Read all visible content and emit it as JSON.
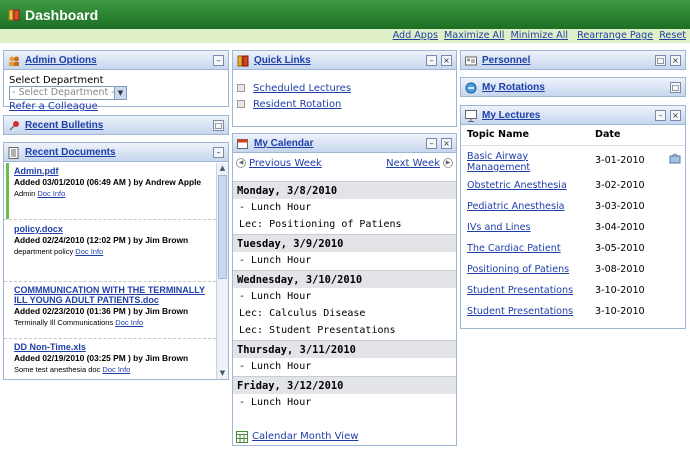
{
  "header": {
    "title": "Dashboard"
  },
  "toolbar": {
    "add_apps": "Add Apps",
    "maximize_all": "Maximize All",
    "minimize_all": "Minimize All",
    "rearrange_page": "Rearrange Page",
    "reset": "Reset"
  },
  "admin": {
    "title": "Admin Options",
    "select_label": "Select Department",
    "select_value": "- Select Department -",
    "refer": "Refer a Colleague"
  },
  "bulletins": {
    "title": "Recent Bulletins"
  },
  "documents": {
    "title": "Recent Documents",
    "doc_info": "Doc Info",
    "items": [
      {
        "name": "Admin.pdf",
        "added": "Added 03/01/2010 (06:49 AM ) by Andrew Apple",
        "desc": "Admin"
      },
      {
        "name": "policy.docx",
        "added": "Added 02/24/2010 (12:02 PM ) by Jim Brown",
        "desc": "department policy"
      },
      {
        "name": "COMMMUNICATION WITH THE TERMINALLY ILL YOUNG ADULT PATIENTS.doc",
        "added": "Added 02/23/2010 (01:36 PM ) by Jim Brown",
        "desc": "Terminally Ill Communications"
      },
      {
        "name": "DD Non-Time.xls",
        "added": "Added 02/19/2010 (03:25 PM ) by Jim Brown",
        "desc": "Some test anesthesia doc"
      }
    ]
  },
  "quicklinks": {
    "title": "Quick Links",
    "items": [
      "Scheduled Lectures",
      "Resident Rotation"
    ]
  },
  "calendar": {
    "title": "My Calendar",
    "prev": "Previous Week",
    "next": "Next Week",
    "month_view": "Calendar Month View",
    "days": [
      {
        "date": "Monday, 3/8/2010",
        "items": [
          "- Lunch Hour",
          "Lec: Positioning of Patiens"
        ]
      },
      {
        "date": "Tuesday, 3/9/2010",
        "items": [
          "- Lunch Hour"
        ]
      },
      {
        "date": "Wednesday, 3/10/2010",
        "items": [
          "- Lunch Hour",
          "Lec: Calculus Disease",
          "Lec: Student Presentations"
        ]
      },
      {
        "date": "Thursday, 3/11/2010",
        "items": [
          "- Lunch Hour"
        ]
      },
      {
        "date": "Friday, 3/12/2010",
        "items": [
          "- Lunch Hour"
        ]
      }
    ]
  },
  "personnel": {
    "title": "Personnel"
  },
  "rotations": {
    "title": "My Rotations"
  },
  "lectures": {
    "title": "My Lectures",
    "col_topic": "Topic Name",
    "col_date": "Date",
    "rows": [
      {
        "topic": "Basic Airway Management",
        "date": "3-01-2010"
      },
      {
        "topic": "Obstetric Anesthesia",
        "date": "3-02-2010"
      },
      {
        "topic": "Pediatric Anesthesia",
        "date": "3-03-2010"
      },
      {
        "topic": "IVs and Lines",
        "date": "3-04-2010"
      },
      {
        "topic": "The Cardiac Patient",
        "date": "3-05-2010"
      },
      {
        "topic": "Positioning of Patiens",
        "date": "3-08-2010"
      },
      {
        "topic": "Student Presentations",
        "date": "3-10-2010"
      },
      {
        "topic": "Student Presentations",
        "date": "3-10-2010"
      }
    ]
  },
  "colors": {
    "header_green": "#2e8b35",
    "toolbar_green": "#dff0c8",
    "link_blue": "#1f3fa8",
    "panel_border": "#9fb6d4"
  }
}
